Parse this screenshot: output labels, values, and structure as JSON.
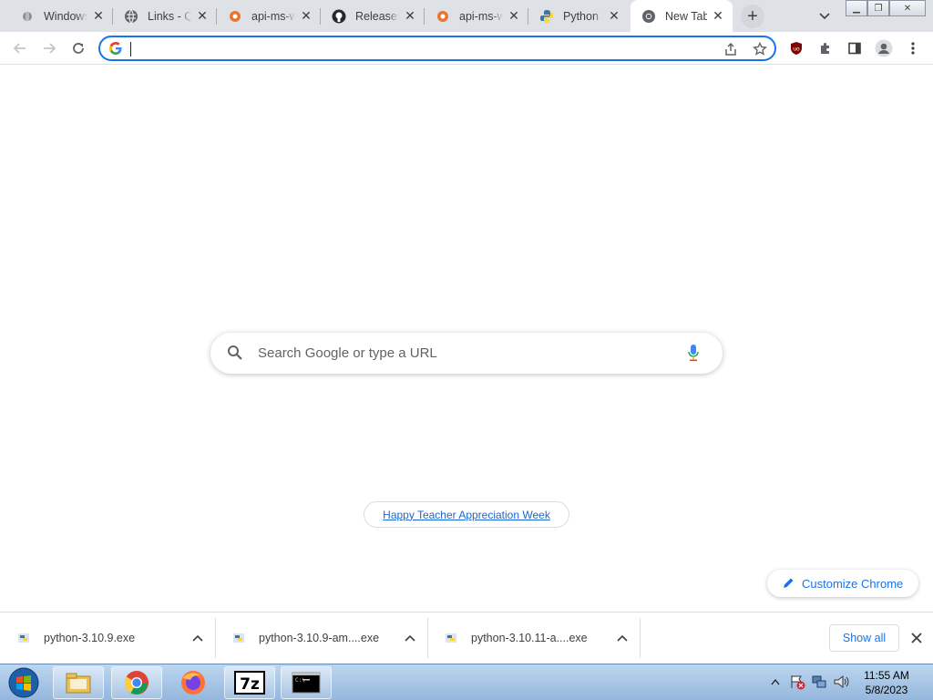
{
  "tabs": [
    {
      "title": "Windows",
      "icon": "windows-app-icon"
    },
    {
      "title": "Links - Qt",
      "icon": "globe-icon"
    },
    {
      "title": "api-ms-win",
      "icon": "gear-flower-icon"
    },
    {
      "title": "Releases",
      "icon": "github-icon"
    },
    {
      "title": "api-ms-win",
      "icon": "gear-flower-icon"
    },
    {
      "title": "Python Re",
      "icon": "python-icon"
    },
    {
      "title": "New Tab",
      "icon": "chrome-icon",
      "active": true
    }
  ],
  "omnibox": {
    "value": "",
    "placeholder": ""
  },
  "ntp": {
    "search_placeholder": "Search Google or type a URL",
    "doodle_link": "Happy Teacher Appreciation Week",
    "customize_label": "Customize Chrome"
  },
  "downloads": [
    {
      "filename": "python-3.10.9.exe"
    },
    {
      "filename": "python-3.10.9-am....exe"
    },
    {
      "filename": "python-3.10.11-a....exe"
    }
  ],
  "shelf": {
    "show_all": "Show all"
  },
  "taskbar": {
    "time": "11:55 AM",
    "date": "5/8/2023",
    "apps": [
      "file-explorer-icon",
      "chrome-icon",
      "firefox-icon",
      "7zip-icon",
      "cmd-icon"
    ]
  },
  "colors": {
    "accent": "#1a73e8",
    "tabstrip": "#dee1e6",
    "ublock": "#800000"
  }
}
